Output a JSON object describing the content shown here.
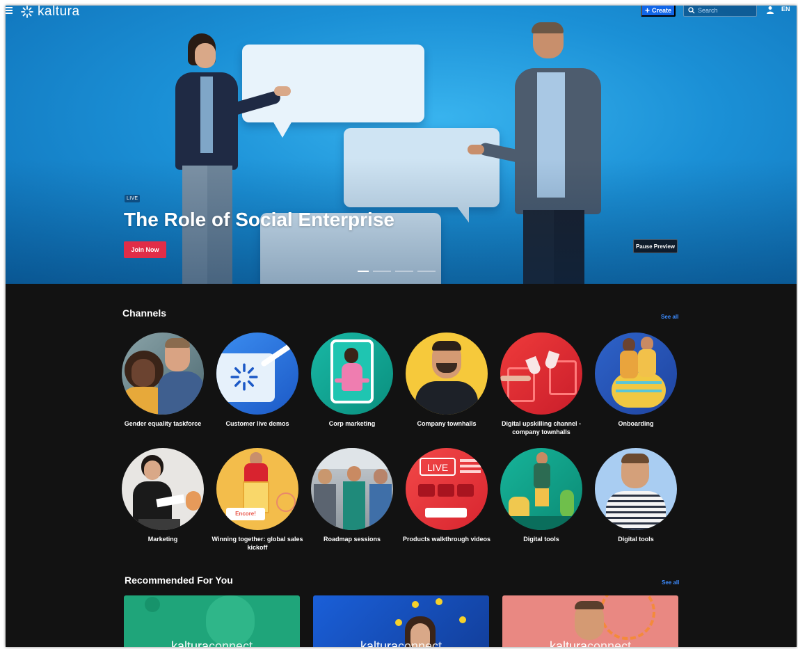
{
  "header": {
    "brand": "kaltura",
    "create_label": "Create",
    "search_placeholder": "Search",
    "language": "EN"
  },
  "hero": {
    "badge": "LIVE",
    "title": "The Role of Social Enterprise",
    "join_label": "Join Now",
    "pause_label": "Pause Preview",
    "slides": 4,
    "active_slide": 1
  },
  "channels": {
    "title": "Channels",
    "see_all": "See all",
    "items": [
      {
        "label": "Gender equality taskforce"
      },
      {
        "label": "Customer live demos"
      },
      {
        "label": "Corp marketing"
      },
      {
        "label": "Company townhalls"
      },
      {
        "label": "Digital upskilling channel - company townhalls"
      },
      {
        "label": "Onboarding"
      },
      {
        "label": "Marketing"
      },
      {
        "label": "Winning together: global sales kickoff"
      },
      {
        "label": "Roadmap sessions"
      },
      {
        "label": "Products walkthrough videos"
      },
      {
        "label": "Digital tools"
      },
      {
        "label": "Digital tools"
      }
    ],
    "overlay_text": {
      "encore": "Encore!",
      "live": "LIVE"
    }
  },
  "recommended": {
    "title": "Recommended For You",
    "see_all": "See all",
    "cards": [
      {
        "brand_a": "kaltura",
        "brand_b": "connect",
        "bg": "#1fa57a"
      },
      {
        "brand_a": "kaltura",
        "brand_b": "connect",
        "bg": "#1a5fd8"
      },
      {
        "brand_a": "kaltura",
        "brand_b": "connect",
        "bg": "#e98882"
      }
    ]
  },
  "colors": {
    "accent": "#1166e8",
    "join": "#e12d48",
    "link": "#3d8cff",
    "page_bg": "#121212"
  }
}
